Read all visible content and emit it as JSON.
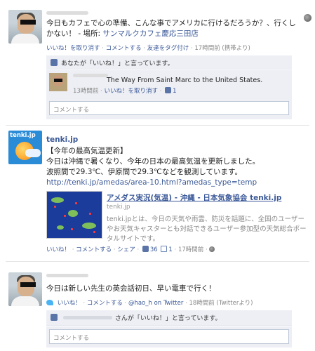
{
  "post1": {
    "text": "今日もカフェで心の準備、こんな事でアメリカに行けるだろうか？、行くしかない！ - 場所: ",
    "place": "サンマルクカフェ慶応三田店",
    "actions": {
      "unlike": "いいね！を取り消す",
      "comment": "コメントする",
      "tag": "友達をタグ付け",
      "time": "17時間前",
      "via": "(携帯より)"
    },
    "like_summary": "あなたが「いいね！」と言っています。",
    "reply": {
      "text": "The Way From Saint Marc to the United States.",
      "time": "13時間前",
      "unlike": "いいね！を取り消す",
      "like_count": "1"
    },
    "comment_placeholder": "コメントする"
  },
  "post2": {
    "author": "tenki.jp",
    "logo_text": "tenki.jp",
    "line1": "【今年の最高気温更新】",
    "line2": "今日は沖縄で暑くなり、今年の日本の最高気温を更新しました。",
    "line3": "波照間で29.3℃、伊原間で29.3℃などを観測しています。",
    "url": "http://tenki.jp/amedas/area-10.html?amedas_type=temp",
    "link": {
      "title": "アメダス実況(気温) - 沖縄 - 日本気象協会 tenki.jp",
      "domain": "tenki.jp",
      "description": "tenki.jpとは、今日の天気や雨雲、防災を話題に、全国のユーザーやお天気キャスターとも対話できるユーザー参加型の天気総合ポータルサイトです。"
    },
    "actions": {
      "like": "いいね！",
      "comment": "コメントする",
      "share": "シェア",
      "like_count": "36",
      "comment_count": "1",
      "time": "17時間前"
    }
  },
  "post3": {
    "text": "今日は新しい先生の英会話初日、早い電車で行く！",
    "actions": {
      "like": "いいね！",
      "comment": "コメントする",
      "twitter": "@hao_h on Twitter",
      "time": "18時間前",
      "via": "(Twitterより)"
    },
    "like_summary": "さんが「いいね！」と言っています。",
    "comment_placeholder": "コメントする"
  },
  "colors": {
    "link": "#3b5998",
    "like_bg": "#edeff4"
  }
}
